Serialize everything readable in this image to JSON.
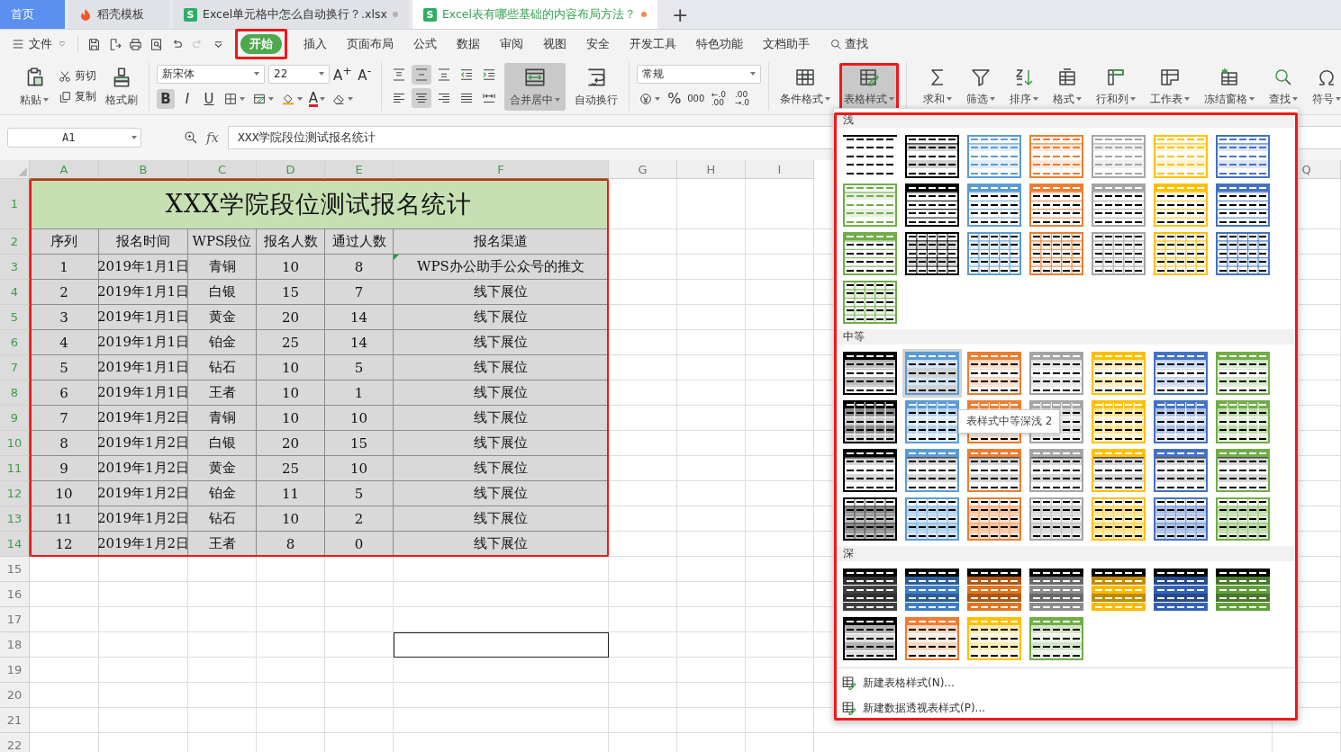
{
  "tabs": [
    {
      "label": "首页",
      "kind": "home",
      "selected": false
    },
    {
      "label": "稻壳模板",
      "kind": "docer",
      "selected": false
    },
    {
      "label": "Excel单元格中怎么自动换行？.xlsx",
      "kind": "sheet",
      "icon_letter": "S",
      "selected": false,
      "modified": false
    },
    {
      "label": "Excel表有哪些基础的内容布局方法？",
      "kind": "sheet",
      "icon_letter": "S",
      "selected": true,
      "modified": true
    }
  ],
  "new_tab": "+",
  "file_menu": {
    "label": "文件"
  },
  "quick_access": [
    {
      "kind": "save",
      "disabled": false
    },
    {
      "kind": "export",
      "disabled": false
    },
    {
      "kind": "print",
      "disabled": false
    },
    {
      "kind": "preview",
      "disabled": false
    },
    {
      "kind": "undo",
      "disabled": false
    },
    {
      "kind": "redo",
      "disabled": true
    },
    {
      "kind": "more",
      "disabled": false
    }
  ],
  "menu_tabs": [
    {
      "label": "开始",
      "selected": true,
      "highlighted": true
    },
    {
      "label": "插入",
      "selected": false
    },
    {
      "label": "页面布局",
      "selected": false
    },
    {
      "label": "公式",
      "selected": false
    },
    {
      "label": "数据",
      "selected": false
    },
    {
      "label": "审阅",
      "selected": false
    },
    {
      "label": "视图",
      "selected": false
    },
    {
      "label": "安全",
      "selected": false
    },
    {
      "label": "开发工具",
      "selected": false
    },
    {
      "label": "特色功能",
      "selected": false
    },
    {
      "label": "文档助手",
      "selected": false
    },
    {
      "label": "查找",
      "selected": false,
      "kind": "search"
    }
  ],
  "ribbon": {
    "clipboard": {
      "paste": "粘贴",
      "cut": "剪切",
      "copy": "复制",
      "painter": "格式刷"
    },
    "font": {
      "name": "新宋体",
      "size": "22",
      "grow": "A$^{+}$",
      "shrink": "A$^{-}$",
      "color_glyph": "A",
      "styles": [
        {
          "glyph": "B",
          "kind": "bold",
          "selected": true
        },
        {
          "glyph": "I",
          "kind": "italic",
          "selected": false
        },
        {
          "glyph": "U",
          "kind": "underline",
          "selected": false
        }
      ]
    },
    "alignment": [
      {
        "kind": "top",
        "selected": false
      },
      {
        "kind": "middle",
        "selected": true
      },
      {
        "kind": "bottom",
        "selected": false
      },
      {
        "kind": "indent_less",
        "selected": false
      },
      {
        "kind": "indent_more",
        "selected": false
      },
      {
        "kind": "left",
        "selected": false
      },
      {
        "kind": "center",
        "selected": true
      },
      {
        "kind": "right",
        "selected": false
      },
      {
        "kind": "justify",
        "selected": false
      },
      {
        "kind": "distributed",
        "selected": false
      }
    ],
    "merge": {
      "label": "合并居中",
      "selected": true
    },
    "wrap": {
      "label": "自动换行",
      "selected": false
    },
    "number": {
      "format": "常规",
      "buttons": [
        {
          "kind": "currency"
        },
        {
          "kind": "glyph",
          "text": "%"
        },
        {
          "kind": "glyph",
          "text": "000"
        },
        {
          "kind": "stack",
          "top": "←.0",
          "bottom": ".00"
        },
        {
          "kind": "stack",
          "top": ".00",
          "bottom": "→.0"
        }
      ]
    },
    "tools": [
      {
        "label": "条件格式",
        "kind": "conditional",
        "selected": false
      },
      {
        "label": "表格样式",
        "kind": "table_style",
        "selected": true,
        "highlighted": true
      }
    ],
    "actions": [
      {
        "label": "求和",
        "kind": "sum"
      },
      {
        "label": "筛选",
        "kind": "filter"
      },
      {
        "label": "排序",
        "kind": "sort"
      },
      {
        "label": "格式",
        "kind": "format"
      },
      {
        "label": "行和列",
        "kind": "rowcol"
      },
      {
        "label": "工作表",
        "kind": "sheet"
      },
      {
        "label": "冻结窗格",
        "kind": "freeze"
      },
      {
        "label": "查找",
        "kind": "find"
      },
      {
        "label": "符号",
        "kind": "symbol"
      }
    ]
  },
  "formula_bar": {
    "cell": "A1",
    "fx": "fx",
    "value": "XXX学院段位测试报名统计"
  },
  "columns": [
    {
      "label": "A",
      "selected": true
    },
    {
      "label": "B",
      "selected": true
    },
    {
      "label": "C",
      "selected": true
    },
    {
      "label": "D",
      "selected": true
    },
    {
      "label": "E",
      "selected": true
    },
    {
      "label": "F",
      "selected": true
    },
    {
      "label": "G",
      "selected": false
    },
    {
      "label": "H",
      "selected": false
    },
    {
      "label": "I",
      "selected": false
    },
    {
      "label": "Q",
      "selected": false
    }
  ],
  "table": {
    "highlighted": true,
    "title": {
      "row": "1",
      "selected": true,
      "text": "XXX学院段位测试报名统计"
    },
    "header": {
      "row": "2",
      "selected": true,
      "cells": [
        "序列",
        "报名时间",
        "WPS段位",
        "报名人数",
        "通过人数",
        "报名渠道"
      ]
    },
    "records": [
      {
        "row": "3",
        "selected": true,
        "flagged": true,
        "cells": [
          "1",
          "2019年1月1日",
          "青铜",
          "10",
          "8",
          "WPS办公助手公众号的推文"
        ]
      },
      {
        "row": "4",
        "selected": true,
        "flagged": false,
        "cells": [
          "2",
          "2019年1月1日",
          "白银",
          "15",
          "7",
          "线下展位"
        ]
      },
      {
        "row": "5",
        "selected": true,
        "flagged": false,
        "cells": [
          "3",
          "2019年1月1日",
          "黄金",
          "20",
          "14",
          "线下展位"
        ]
      },
      {
        "row": "6",
        "selected": true,
        "flagged": false,
        "cells": [
          "4",
          "2019年1月1日",
          "铂金",
          "25",
          "14",
          "线下展位"
        ]
      },
      {
        "row": "7",
        "selected": true,
        "flagged": false,
        "cells": [
          "5",
          "2019年1月1日",
          "钻石",
          "10",
          "5",
          "线下展位"
        ]
      },
      {
        "row": "8",
        "selected": true,
        "flagged": false,
        "cells": [
          "6",
          "2019年1月1日",
          "王者",
          "10",
          "1",
          "线下展位"
        ]
      },
      {
        "row": "9",
        "selected": true,
        "flagged": false,
        "cells": [
          "7",
          "2019年1月2日",
          "青铜",
          "10",
          "10",
          "线下展位"
        ]
      },
      {
        "row": "10",
        "selected": true,
        "flagged": false,
        "cells": [
          "8",
          "2019年1月2日",
          "白银",
          "20",
          "15",
          "线下展位"
        ]
      },
      {
        "row": "11",
        "selected": true,
        "flagged": false,
        "cells": [
          "9",
          "2019年1月2日",
          "黄金",
          "25",
          "10",
          "线下展位"
        ]
      },
      {
        "row": "12",
        "selected": true,
        "flagged": false,
        "cells": [
          "10",
          "2019年1月2日",
          "铂金",
          "11",
          "5",
          "线下展位"
        ]
      },
      {
        "row": "13",
        "selected": true,
        "flagged": false,
        "cells": [
          "11",
          "2019年1月2日",
          "钻石",
          "10",
          "2",
          "线下展位"
        ]
      },
      {
        "row": "14",
        "selected": true,
        "flagged": false,
        "cells": [
          "12",
          "2019年1月2日",
          "王者",
          "8",
          "0",
          "线下展位"
        ]
      }
    ]
  },
  "empty_rows": [
    {
      "row": "15",
      "outlined": false
    },
    {
      "row": "16",
      "outlined": false
    },
    {
      "row": "17",
      "outlined": false
    },
    {
      "row": "18",
      "outlined": true
    },
    {
      "row": "19",
      "outlined": false
    },
    {
      "row": "20",
      "outlined": false
    },
    {
      "row": "21",
      "outlined": false
    },
    {
      "row": "22",
      "outlined": false
    }
  ],
  "style_gallery": {
    "highlighted": true,
    "tooltip": "表样式中等深浅 2",
    "sections": [
      {
        "title": "浅",
        "styles": [
          {
            "kind": "none",
            "color": "#000000",
            "selected": false
          },
          {
            "kind": "light_bands",
            "color": "#000000",
            "selected": false
          },
          {
            "kind": "light_bands",
            "color": "#5b9bd5",
            "selected": false
          },
          {
            "kind": "light_bands",
            "color": "#ed7d31",
            "selected": false
          },
          {
            "kind": "light_bands",
            "color": "#a5a5a5",
            "selected": false
          },
          {
            "kind": "light_bands",
            "color": "#ffc000",
            "selected": false
          },
          {
            "kind": "light_bands",
            "color": "#4472c4",
            "selected": false
          },
          {
            "kind": "light_bands",
            "color": "#70ad47",
            "selected": false
          },
          {
            "kind": "light_header",
            "color": "#000000",
            "selected": false
          },
          {
            "kind": "light_header",
            "color": "#5b9bd5",
            "selected": false
          },
          {
            "kind": "light_header",
            "color": "#ed7d31",
            "selected": false
          },
          {
            "kind": "light_header",
            "color": "#a5a5a5",
            "selected": false
          },
          {
            "kind": "light_header",
            "color": "#ffc000",
            "selected": false
          },
          {
            "kind": "light_header",
            "color": "#4472c4",
            "selected": false
          },
          {
            "kind": "light_header",
            "color": "#70ad47",
            "selected": false
          },
          {
            "kind": "light_grid",
            "color": "#000000",
            "selected": false
          },
          {
            "kind": "light_grid",
            "color": "#5b9bd5",
            "selected": false
          },
          {
            "kind": "light_grid",
            "color": "#ed7d31",
            "selected": false
          },
          {
            "kind": "light_grid",
            "color": "#a5a5a5",
            "selected": false
          },
          {
            "kind": "light_grid",
            "color": "#ffc000",
            "selected": false
          },
          {
            "kind": "light_grid",
            "color": "#4472c4",
            "selected": false
          },
          {
            "kind": "light_grid",
            "color": "#70ad47",
            "selected": false
          }
        ]
      },
      {
        "title": "中等",
        "styles": [
          {
            "kind": "medium_bands",
            "color": "#000000",
            "selected": false
          },
          {
            "kind": "medium_bands",
            "color": "#5b9bd5",
            "selected": true
          },
          {
            "kind": "medium_bands",
            "color": "#ed7d31",
            "selected": false
          },
          {
            "kind": "medium_bands",
            "color": "#a5a5a5",
            "selected": false
          },
          {
            "kind": "medium_bands",
            "color": "#ffc000",
            "selected": false
          },
          {
            "kind": "medium_bands",
            "color": "#4472c4",
            "selected": false
          },
          {
            "kind": "medium_bands",
            "color": "#70ad47",
            "selected": false
          },
          {
            "kind": "medium_grid",
            "color": "#000000",
            "selected": false
          },
          {
            "kind": "medium_grid",
            "color": "#5b9bd5",
            "selected": false
          },
          {
            "kind": "medium_grid",
            "color": "#ed7d31",
            "selected": false
          },
          {
            "kind": "medium_grid",
            "color": "#a5a5a5",
            "selected": false
          },
          {
            "kind": "medium_grid",
            "color": "#ffc000",
            "selected": false
          },
          {
            "kind": "medium_grid",
            "color": "#4472c4",
            "selected": false
          },
          {
            "kind": "medium_grid",
            "color": "#70ad47",
            "selected": false
          },
          {
            "kind": "medium_rule",
            "color": "#000000",
            "selected": false
          },
          {
            "kind": "medium_rule",
            "color": "#5b9bd5",
            "selected": false
          },
          {
            "kind": "medium_rule",
            "color": "#ed7d31",
            "selected": false
          },
          {
            "kind": "medium_rule",
            "color": "#a5a5a5",
            "selected": false
          },
          {
            "kind": "medium_rule",
            "color": "#ffc000",
            "selected": false
          },
          {
            "kind": "medium_rule",
            "color": "#4472c4",
            "selected": false
          },
          {
            "kind": "medium_rule",
            "color": "#70ad47",
            "selected": false
          },
          {
            "kind": "medium_fullgrid",
            "color": "#000000",
            "selected": false
          },
          {
            "kind": "medium_fullgrid",
            "color": "#5b9bd5",
            "selected": false
          },
          {
            "kind": "medium_fullgrid",
            "color": "#ed7d31",
            "selected": false
          },
          {
            "kind": "medium_fullgrid",
            "color": "#a5a5a5",
            "selected": false
          },
          {
            "kind": "medium_fullgrid",
            "color": "#ffc000",
            "selected": false
          },
          {
            "kind": "medium_fullgrid",
            "color": "#4472c4",
            "selected": false
          },
          {
            "kind": "medium_fullgrid",
            "color": "#70ad47",
            "selected": false
          }
        ]
      },
      {
        "title": "深",
        "styles": [
          {
            "kind": "dark",
            "color": "#404040",
            "selected": false
          },
          {
            "kind": "dark",
            "color": "#3d7cc9",
            "selected": false
          },
          {
            "kind": "dark",
            "color": "#e2741f",
            "selected": false
          },
          {
            "kind": "dark",
            "color": "#8c8c8c",
            "selected": false
          },
          {
            "kind": "dark",
            "color": "#ffb900",
            "selected": false
          },
          {
            "kind": "dark",
            "color": "#3461b8",
            "selected": false
          },
          {
            "kind": "dark",
            "color": "#62a03a",
            "selected": false
          },
          {
            "kind": "dark_light",
            "color": "#000000",
            "selected": false
          },
          {
            "kind": "dark_light",
            "color": "#ed7d31",
            "selected": false
          },
          {
            "kind": "dark_light",
            "color": "#ffc000",
            "selected": false
          },
          {
            "kind": "dark_light",
            "color": "#70ad47",
            "selected": false
          }
        ]
      }
    ],
    "actions": [
      "新建表格样式(N)...",
      "新建数据透视表样式(P)..."
    ]
  }
}
